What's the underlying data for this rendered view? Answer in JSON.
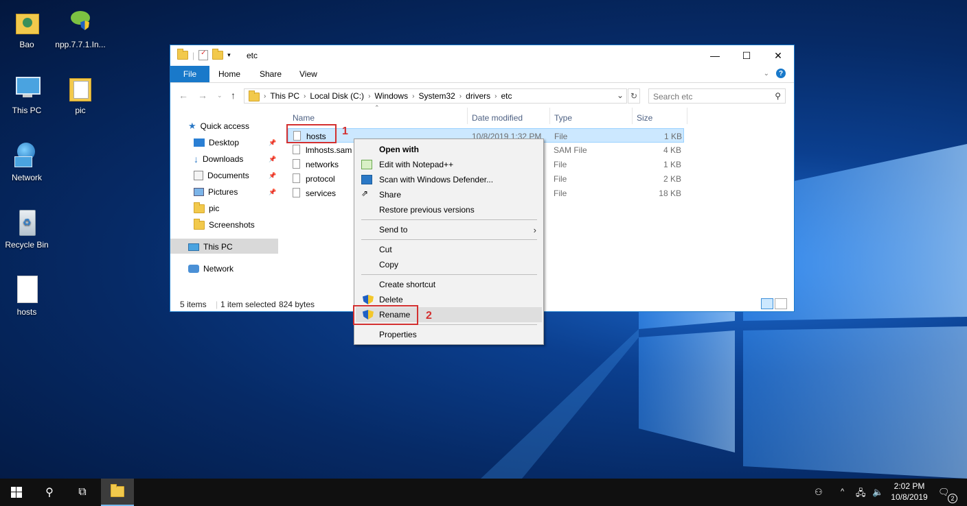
{
  "desktop": {
    "icons": [
      {
        "label": "Bao"
      },
      {
        "label": "npp.7.7.1.In..."
      },
      {
        "label": "This PC"
      },
      {
        "label": "pic"
      },
      {
        "label": "Network"
      },
      {
        "label": "Recycle Bin"
      },
      {
        "label": "hosts"
      }
    ]
  },
  "window": {
    "title": "etc",
    "controls": {
      "minimize": "—",
      "maximize": "☐",
      "close": "✕"
    },
    "ribbon_tabs": [
      "File",
      "Home",
      "Share",
      "View"
    ],
    "address": {
      "crumbs": [
        "This PC",
        "Local Disk (C:)",
        "Windows",
        "System32",
        "drivers",
        "etc"
      ]
    },
    "search": {
      "placeholder": "Search etc"
    },
    "nav": {
      "quick_access": "Quick access",
      "items": [
        "Desktop",
        "Downloads",
        "Documents",
        "Pictures",
        "pic",
        "Screenshots"
      ],
      "this_pc": "This PC",
      "network": "Network"
    },
    "columns": [
      "Name",
      "Date modified",
      "Type",
      "Size"
    ],
    "files": [
      {
        "name": "hosts",
        "date": "10/8/2019 1:32 PM",
        "type": "File",
        "size": "1 KB"
      },
      {
        "name": "lmhosts.sam",
        "date": "",
        "type": "SAM File",
        "size": "4 KB"
      },
      {
        "name": "networks",
        "date": "",
        "type": "File",
        "size": "1 KB"
      },
      {
        "name": "protocol",
        "date": "",
        "type": "File",
        "size": "2 KB"
      },
      {
        "name": "services",
        "date": "",
        "type": "File",
        "size": "18 KB"
      }
    ],
    "status": {
      "count": "5 items",
      "selected": "1 item selected",
      "size": "824 bytes"
    }
  },
  "context_menu": {
    "items": [
      "Open with",
      "Edit with Notepad++",
      "Scan with Windows Defender...",
      "Share",
      "Restore previous versions",
      "Send to",
      "Cut",
      "Copy",
      "Create shortcut",
      "Delete",
      "Rename",
      "Properties"
    ]
  },
  "annotations": {
    "step1": "1",
    "step2": "2"
  },
  "taskbar": {
    "time": "2:02 PM",
    "date": "10/8/2019",
    "notification_count": "2"
  },
  "colors": {
    "accent": "#1979ca",
    "annotation": "#d32f2f",
    "selection": "#cce8ff"
  }
}
